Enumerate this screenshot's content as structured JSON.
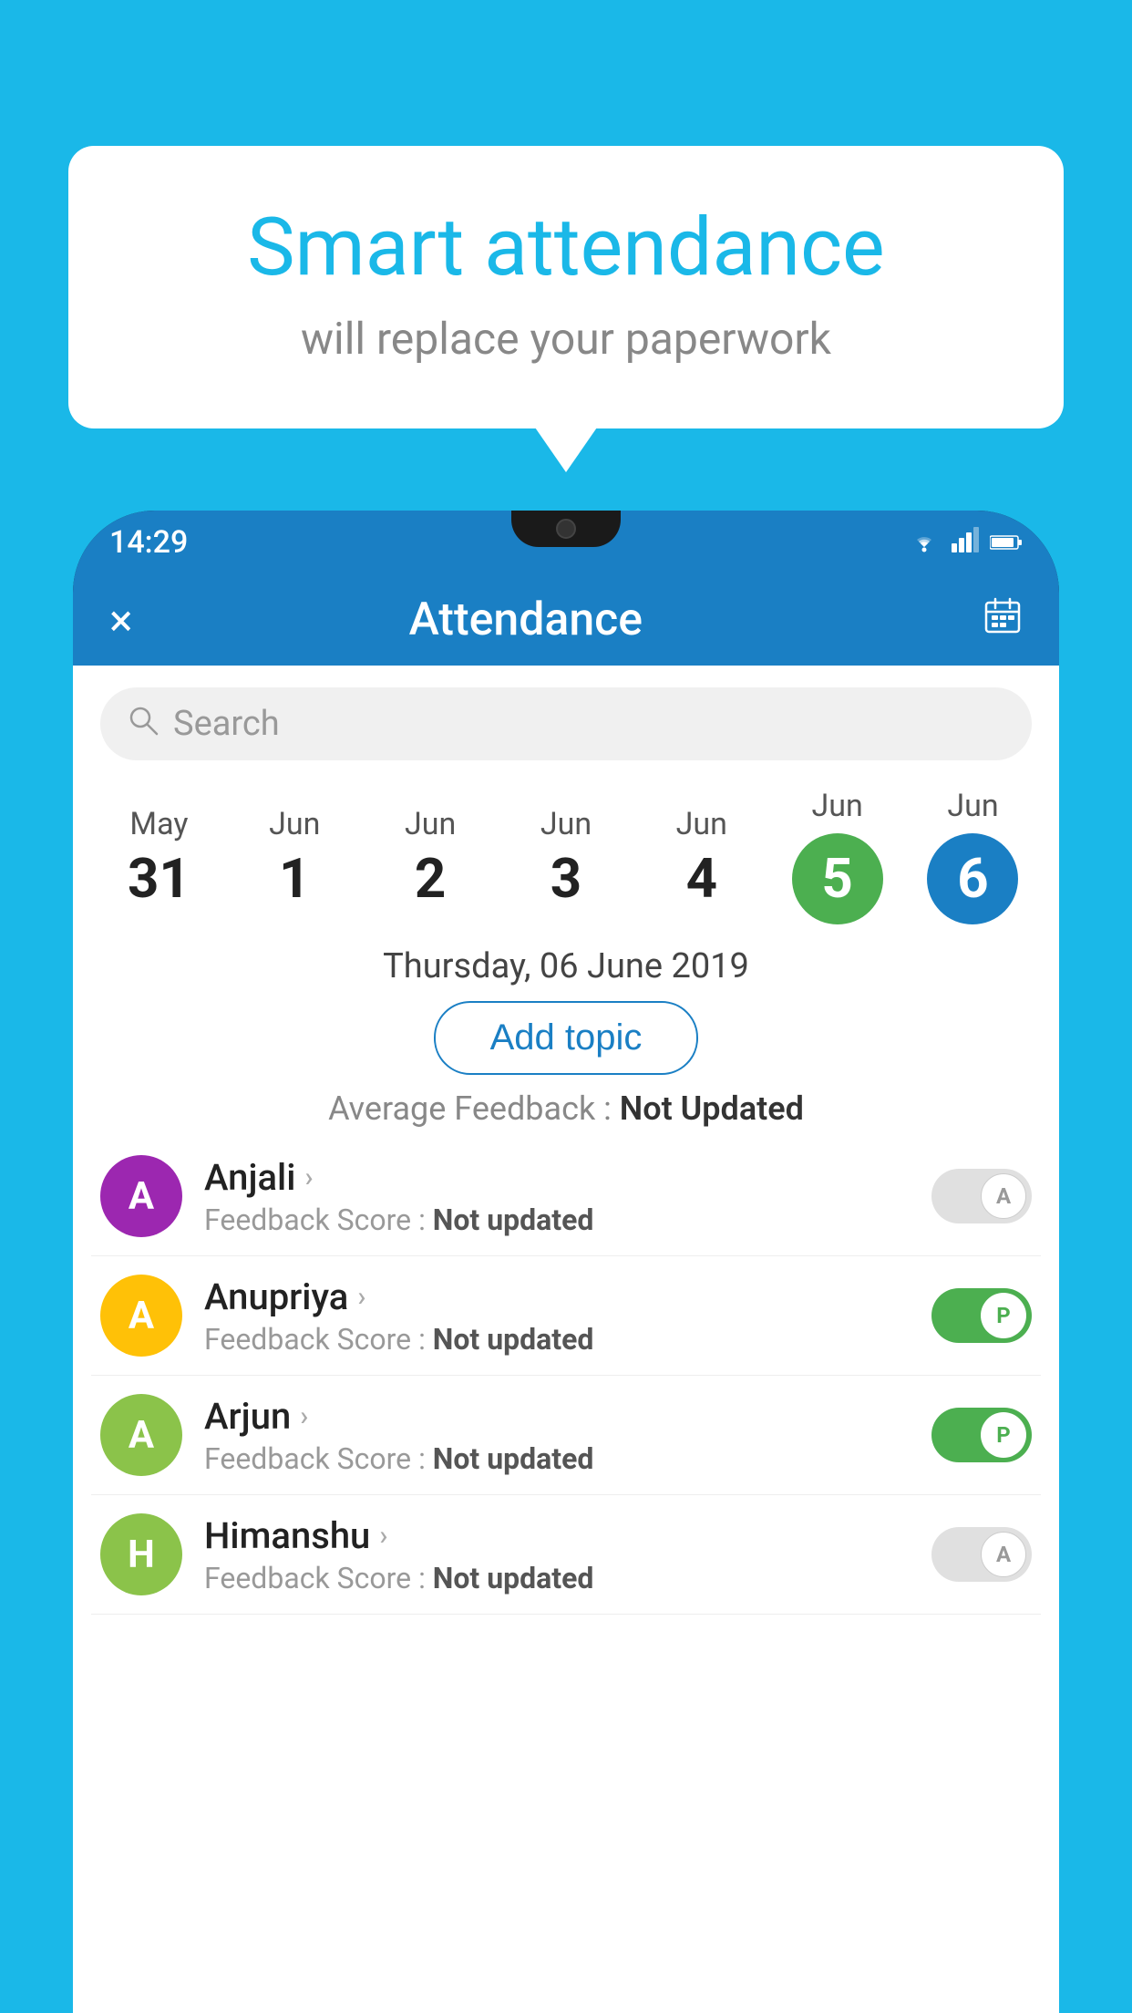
{
  "background_color": "#1ab8e8",
  "speech_bubble": {
    "title": "Smart attendance",
    "subtitle": "will replace your paperwork"
  },
  "status_bar": {
    "time": "14:29",
    "icons": [
      "wifi",
      "signal",
      "battery"
    ]
  },
  "app_bar": {
    "close_icon": "×",
    "title": "Attendance",
    "calendar_icon": "📅"
  },
  "search": {
    "placeholder": "Search"
  },
  "calendar": {
    "days": [
      {
        "month": "May",
        "date": "31",
        "selected": false
      },
      {
        "month": "Jun",
        "date": "1",
        "selected": false
      },
      {
        "month": "Jun",
        "date": "2",
        "selected": false
      },
      {
        "month": "Jun",
        "date": "3",
        "selected": false
      },
      {
        "month": "Jun",
        "date": "4",
        "selected": false
      },
      {
        "month": "Jun",
        "date": "5",
        "selected": "green"
      },
      {
        "month": "Jun",
        "date": "6",
        "selected": "blue"
      }
    ]
  },
  "selected_date_label": "Thursday, 06 June 2019",
  "add_topic_label": "Add topic",
  "average_feedback_label": "Average Feedback :",
  "average_feedback_value": "Not Updated",
  "students": [
    {
      "name": "Anjali",
      "avatar_letter": "A",
      "avatar_color": "#9c27b0",
      "feedback_label": "Feedback Score :",
      "feedback_value": "Not updated",
      "attendance": "off",
      "toggle_label": "A"
    },
    {
      "name": "Anupriya",
      "avatar_letter": "A",
      "avatar_color": "#ffc107",
      "feedback_label": "Feedback Score :",
      "feedback_value": "Not updated",
      "attendance": "on",
      "toggle_label": "P"
    },
    {
      "name": "Arjun",
      "avatar_letter": "A",
      "avatar_color": "#8bc34a",
      "feedback_label": "Feedback Score :",
      "feedback_value": "Not updated",
      "attendance": "on",
      "toggle_label": "P"
    },
    {
      "name": "Himanshu",
      "avatar_letter": "H",
      "avatar_color": "#8bc34a",
      "feedback_label": "Feedback Score :",
      "feedback_value": "Not updated",
      "attendance": "off",
      "toggle_label": "A"
    }
  ]
}
